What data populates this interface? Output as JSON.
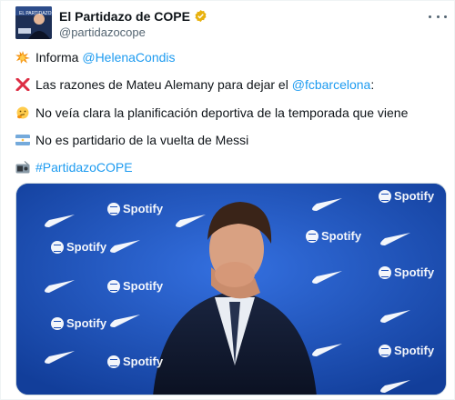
{
  "author": {
    "name": "El Partidazo de COPE",
    "handle": "@partidazocope",
    "avatar_icon": "cope-avatar"
  },
  "tweet": {
    "line1": {
      "icon": "collision-emoji",
      "text": "Informa ",
      "mention": "@HelenaCondis"
    },
    "line2": {
      "icon": "cross-mark-emoji",
      "text": "Las razones de Mateu Alemany para dejar el ",
      "mention": "@fcbarcelona",
      "suffix": ":"
    },
    "line3": {
      "icon": "thinking-face-emoji",
      "text": "No veía clara la planificación deportiva de la temporada que viene"
    },
    "line4": {
      "icon": "argentina-flag-emoji",
      "text": "No es partidario de la vuelta de Messi"
    },
    "line5": {
      "icon": "radio-emoji",
      "hashtag": "#PartidazoCOPE"
    }
  },
  "media": {
    "sponsor_label": "Spotify",
    "alt": "Mateu Alemany"
  },
  "colors": {
    "link": "#1d9bf0",
    "backdrop": "#1b4fb8",
    "verified": "#e8b10d"
  }
}
